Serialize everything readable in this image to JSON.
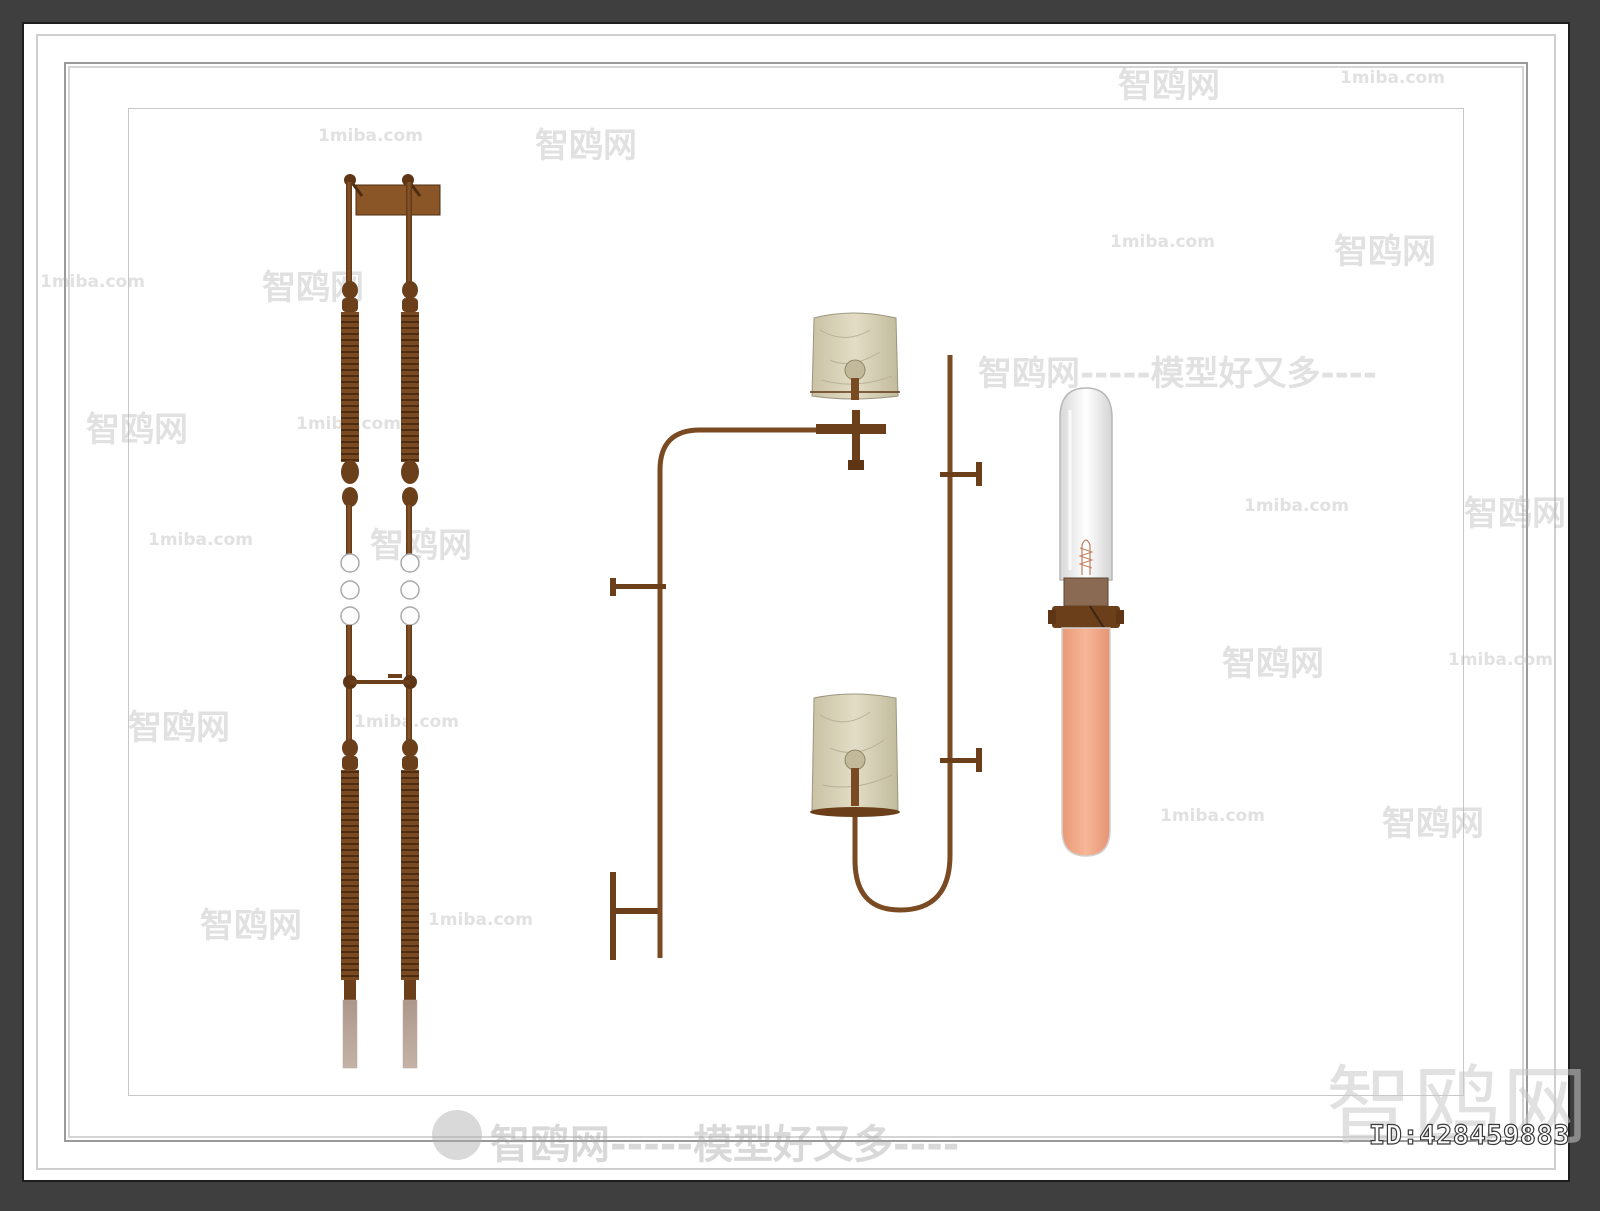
{
  "canvas": {
    "background": "#3f3f3f",
    "paper": "#ffffff",
    "bronze": "#7a4a22",
    "glass_amber": "#d8d2b8",
    "tube_pink": "#f2a887"
  },
  "watermarks": {
    "site": "1miba.com",
    "brand": "智鸥网",
    "dash_brand": "———— 智鸥网 ————",
    "slogan": "智鸥网-----模型好又多----",
    "slogan_mid": "智鸥网-----模型好又多----",
    "corner_brand": "智鸥网"
  },
  "id_label": "ID:428459883"
}
